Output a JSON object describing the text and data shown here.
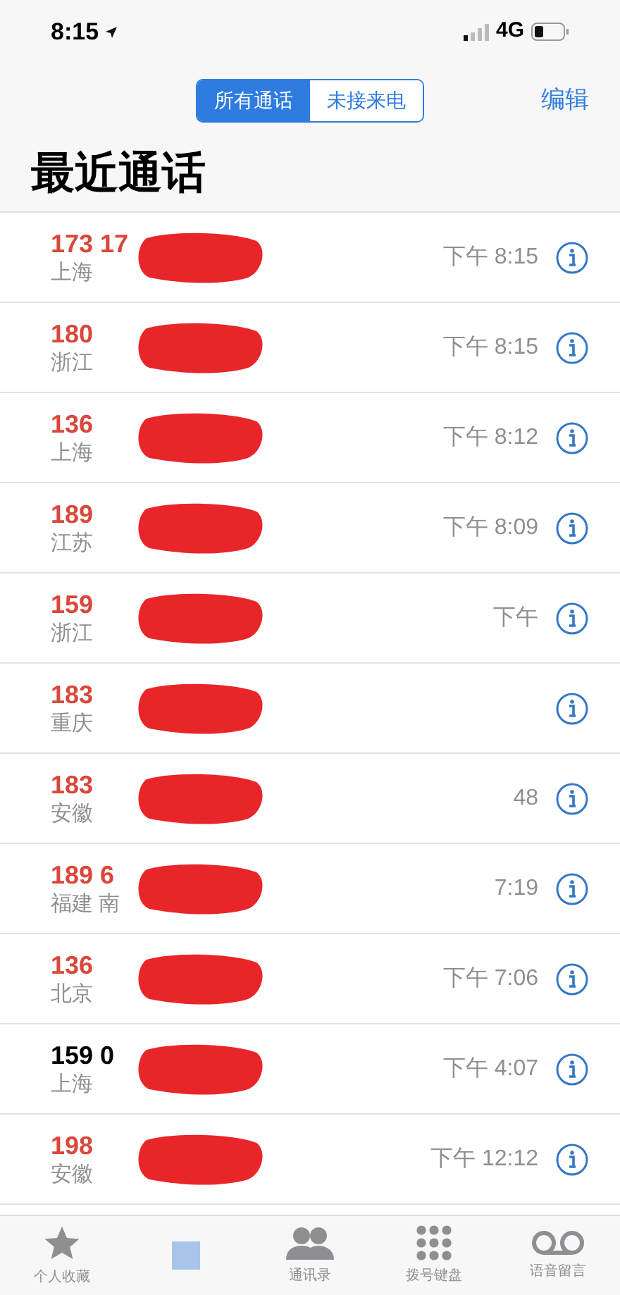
{
  "status_bar": {
    "time": "8:15",
    "network": "4G"
  },
  "segments": [
    {
      "label": "所有通话",
      "selected": true
    },
    {
      "label": "未接来电",
      "selected": false
    }
  ],
  "edit_button": "编辑",
  "title": "最近通话",
  "calls": [
    {
      "number": "173 17",
      "location": "上海",
      "time": "下午 8:15",
      "missed": true
    },
    {
      "number": "180",
      "location": "浙江",
      "time": "下午 8:15",
      "missed": true
    },
    {
      "number": "136",
      "location": "上海",
      "time": "下午 8:12",
      "missed": true
    },
    {
      "number": "189",
      "location": "江苏",
      "time": "下午 8:09",
      "missed": true
    },
    {
      "number": "159",
      "location": "浙江",
      "time": "下午",
      "missed": true
    },
    {
      "number": "183",
      "location": "重庆",
      "missed": true
    },
    {
      "number": "183",
      "location": "安徽",
      "time": "48",
      "missed": true
    },
    {
      "number": "189 6",
      "location": "福建 南",
      "time": "7:19",
      "missed": true
    },
    {
      "number": "136",
      "location": "北京",
      "time": "下午 7:06",
      "missed": true
    },
    {
      "number": "159 0",
      "location": "上海",
      "time": "下午 4:07",
      "missed": false
    },
    {
      "number": "198",
      "location": "安徽",
      "time": "下午 12:12",
      "missed": true
    }
  ],
  "tab_bar": [
    {
      "kind": "star",
      "label": "个人收藏"
    },
    {
      "kind": "obscured"
    },
    {
      "kind": "contacts",
      "label": "通讯录"
    },
    {
      "kind": "keypad",
      "label": "拨号键盘"
    },
    {
      "kind": "voicemail",
      "label": "语音留言"
    }
  ]
}
